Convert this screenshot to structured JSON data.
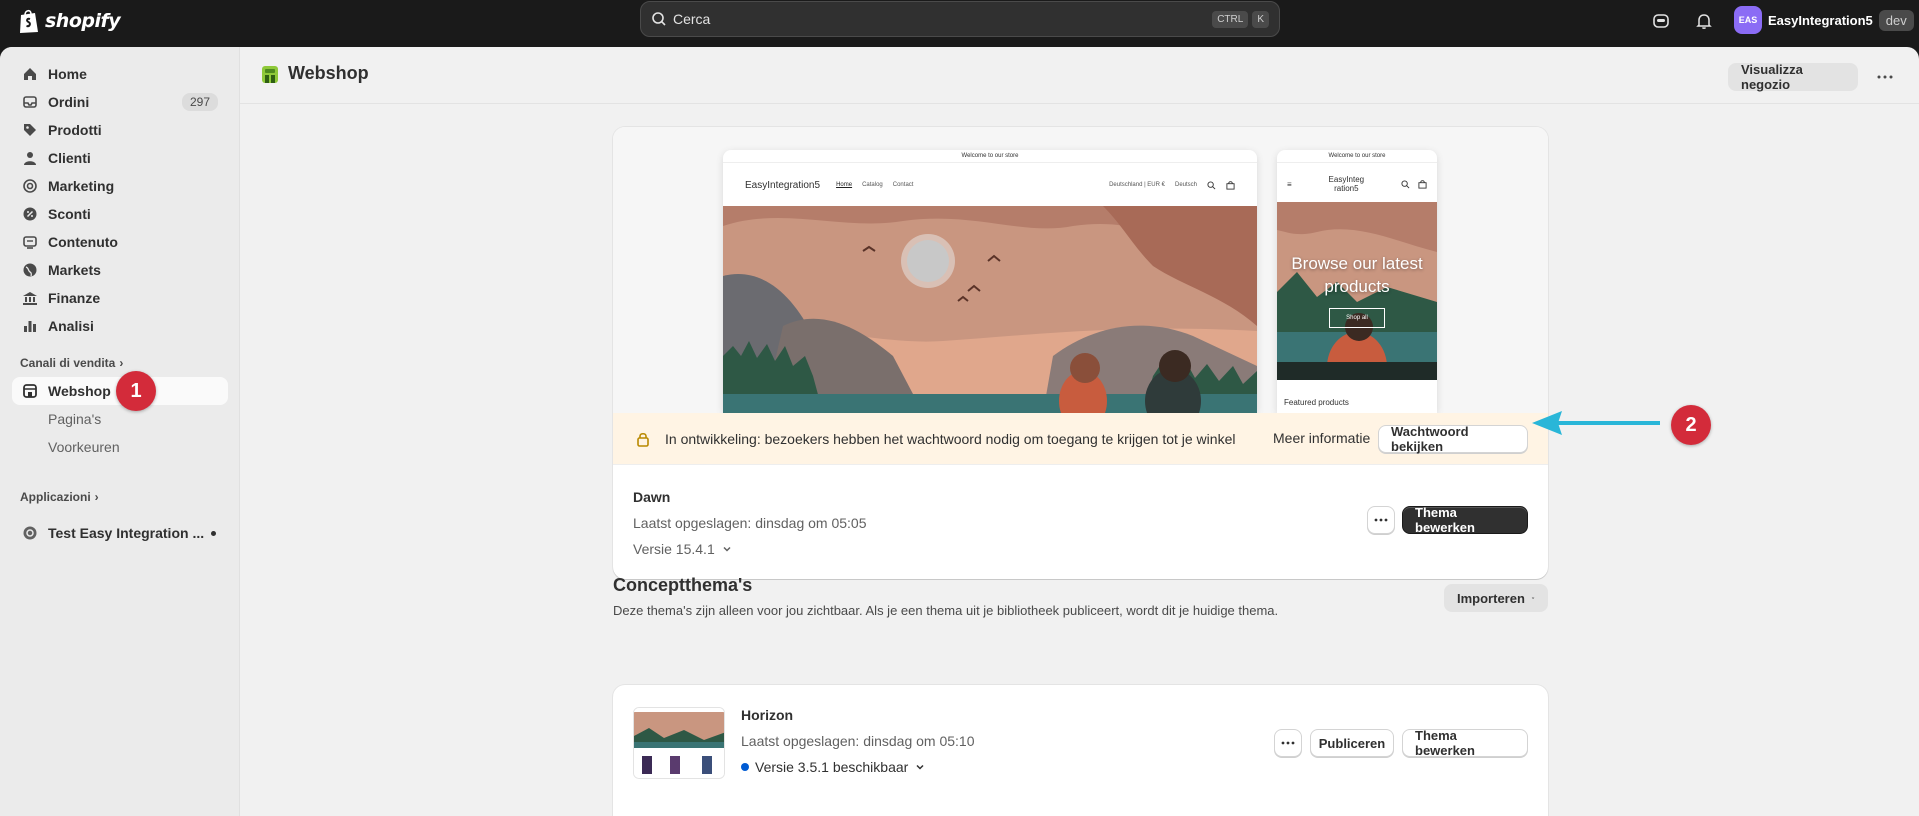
{
  "topbar": {
    "logo_text": "shopify",
    "search_placeholder": "Cerca",
    "shortcut_keys": [
      "CTRL",
      "K"
    ],
    "account": {
      "initials": "EAS",
      "store_name": "EasyIntegration5",
      "badge": "dev"
    }
  },
  "sidebar": {
    "items": [
      {
        "label": "Home",
        "icon": "home-icon"
      },
      {
        "label": "Ordini",
        "icon": "orders-icon",
        "badge": "297"
      },
      {
        "label": "Prodotti",
        "icon": "tag-icon"
      },
      {
        "label": "Clienti",
        "icon": "person-icon"
      },
      {
        "label": "Marketing",
        "icon": "target-icon"
      },
      {
        "label": "Sconti",
        "icon": "discount-icon"
      },
      {
        "label": "Contenuto",
        "icon": "content-icon"
      },
      {
        "label": "Markets",
        "icon": "globe-icon"
      },
      {
        "label": "Finanze",
        "icon": "bank-icon"
      },
      {
        "label": "Analisi",
        "icon": "chart-icon"
      }
    ],
    "sales_channels_label": "Canali di vendita",
    "webshop": {
      "label": "Webshop",
      "sub": [
        "Pagina's",
        "Voorkeuren"
      ]
    },
    "apps_label": "Applicazioni",
    "app_item": "Test Easy Integration ..."
  },
  "markers": [
    "1",
    "2"
  ],
  "page": {
    "title": "Webshop",
    "view_store_button": "Visualizza negozio"
  },
  "preview": {
    "announcement": "Welcome to our store",
    "desktop": {
      "brand": "EasyIntegration5",
      "links": [
        "Home",
        "Catalog",
        "Contact"
      ],
      "locale": "Deutschland | EUR €",
      "language": "Deutsch"
    },
    "mobile": {
      "brand": "EasyInteg ration5",
      "hero_text": "Browse our latest products",
      "hero_button": "Shop all",
      "featured": "Featured products"
    }
  },
  "dev_banner": {
    "text": "In ontwikkeling: bezoekers hebben het wachtwoord nodig om toegang te krijgen tot je winkel",
    "more_info": "Meer informatie",
    "button": "Wachtwoord bekijken"
  },
  "current_theme": {
    "name": "Dawn",
    "last_saved": "Laatst opgeslagen: dinsdag om 05:05",
    "version": "Versie 15.4.1",
    "edit_button": "Thema bewerken"
  },
  "drafts": {
    "title": "Conceptthema's",
    "description": "Deze thema's zijn alleen voor jou zichtbaar. Als je een thema uit je bibliotheek publiceert, wordt dit je huidige thema.",
    "import_button": "Importeren",
    "themes": [
      {
        "name": "Horizon",
        "last_saved": "Laatst opgeslagen: dinsdag om 05:10",
        "version": "Versie 3.5.1 beschikbaar",
        "publish_button": "Publiceren",
        "edit_button": "Thema bewerken"
      }
    ]
  },
  "colors": {
    "topbar": "#1a1a1a",
    "marker_red": "#d32b3a",
    "arrow_cyan": "#29b6d8",
    "dev_banner_bg": "#fff4e4",
    "avatar": "#8b6cf5"
  }
}
